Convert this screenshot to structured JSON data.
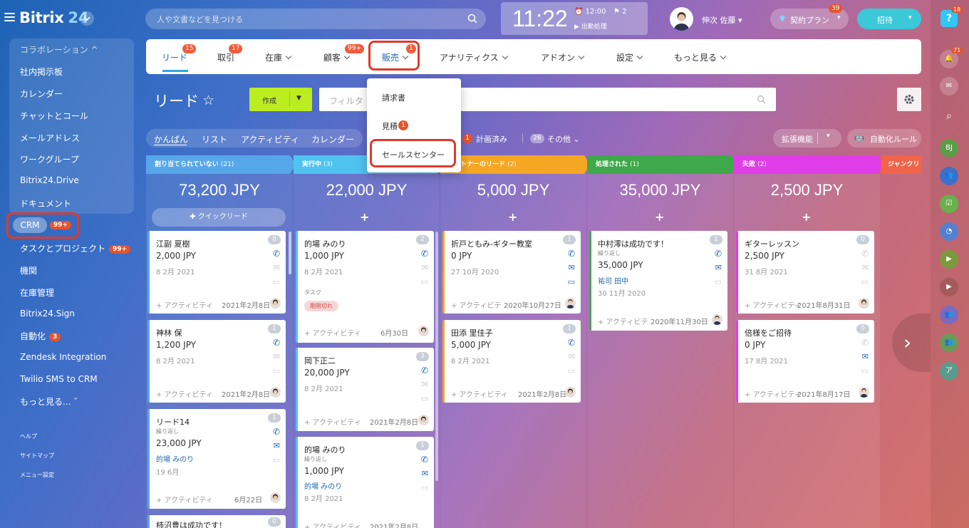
{
  "header": {
    "logo": "Bitrix",
    "logo_num": "24",
    "search_placeholder": "人や文書などを見つける",
    "clock_time": "11:22",
    "alarm": "12:00",
    "flag_count": "2",
    "clock_status": "出勤処理",
    "user_name": "伸次 佐藤",
    "plan_label": "契約プラン",
    "plan_badge": "39",
    "invite_label": "招待"
  },
  "right_strip": {
    "help_badge": "18",
    "bell_badge": "71",
    "avatar_bj": "BJ",
    "avatar_a": "ア"
  },
  "sidebar": {
    "group_title": "コラボレーション",
    "items": [
      "社内掲示板",
      "カレンダー",
      "チャットとコール",
      "メールアドレス",
      "ワークグループ",
      "Bitrix24.Drive",
      "ドキュメント"
    ],
    "crm": "CRM",
    "crm_badge": "99+",
    "items2": [
      "タスクとプロジェクト",
      "機関",
      "在庫管理",
      "Bitrix24.Sign",
      "自動化",
      "Zendesk Integration",
      "Twilio SMS to CRM",
      "もっと見る..."
    ],
    "task_badge": "99+",
    "auto_badge": "3",
    "small": [
      "ヘルプ",
      "サイトマップ",
      "メニュー設定"
    ]
  },
  "menu": {
    "items": [
      "リード",
      "取引",
      "在庫",
      "顧客",
      "販売",
      "アナリティクス",
      "アドオン",
      "設定",
      "もっと見る"
    ],
    "badges": {
      "lead": "15",
      "deal": "17",
      "client": "99+",
      "sales": "1"
    }
  },
  "dropdown": {
    "items": [
      "請求書",
      "見積",
      "セールスセンター"
    ],
    "quote_badge": "1"
  },
  "toolbar": {
    "title": "リード",
    "create": "作成",
    "filter_placeholder": "フィルタ"
  },
  "view_tabs": [
    "かんばん",
    "リスト",
    "アクティビティ",
    "カレンダー"
  ],
  "counters": {
    "planned_count": "1",
    "planned": "計画済み",
    "other_count": "26",
    "other": "その他"
  },
  "ext_label": "拡張機能",
  "auto_rules": "自動化ルール",
  "columns": [
    {
      "title": "割り当てられていない",
      "count": "(21)",
      "total": "73,200 JPY",
      "color": "#56a7ea"
    },
    {
      "title": "実行中",
      "count": "(3)",
      "total": "22,000 JPY",
      "color": "#4fc3ef"
    },
    {
      "title": "トナーのリード",
      "count": "(2)",
      "total": "5,000 JPY",
      "color": "#f5a623"
    },
    {
      "title": "処理された",
      "count": "(1)",
      "total": "35,000 JPY",
      "color": "#3fa84a"
    },
    {
      "title": "失敗",
      "count": "(2)",
      "total": "2,500 JPY",
      "color": "#e03de8"
    },
    {
      "title": "ジャンクリ",
      "count": "",
      "total": "",
      "color": "#f06449"
    }
  ],
  "quick_lead": "クイックリード",
  "cards": {
    "c1": {
      "name": "江副 夏樹",
      "amount": "2,000 JPY",
      "date": "8 2月 2021",
      "act": "+ アクティビティ",
      "adate": "2021年2月8日",
      "count": "0"
    },
    "c2": {
      "name": "神林 保",
      "amount": "1,200 JPY",
      "date": "8 2月 2021",
      "act": "+ アクティビティ",
      "adate": "2021年2月8日",
      "count": "1"
    },
    "c3": {
      "name": "リード14",
      "sub": "繰り返し",
      "amount": "23,000 JPY",
      "contact": "的場 みのり",
      "date": "19 6月",
      "act": "+ アクティビティ",
      "adate": "6月22日",
      "count": "1"
    },
    "c4": {
      "name": "柿沼豊は成功です！",
      "count": "0"
    },
    "c5": {
      "name": "的場 みのり",
      "amount": "1,000 JPY",
      "date": "8 2月 2021",
      "task": "タスク",
      "tag": "期限切れ",
      "act": "+ アクティビティ",
      "adate": "6月30日",
      "count": "2"
    },
    "c6": {
      "name": "岡下正二",
      "amount": "20,000 JPY",
      "date": "8 2月 2021",
      "act": "+ アクティビティ",
      "adate": "2021年2月8日",
      "count": "3"
    },
    "c7": {
      "name": "的場 みのり",
      "sub": "繰り返し",
      "amount": "1,000 JPY",
      "contact": "的場 みのり",
      "date": "8 2月 2021",
      "act": "+ アクティビティ",
      "adate": "2021年2月8日",
      "count": "1"
    },
    "c8": {
      "name": "折戸ともみ-ギター教室",
      "amount": "0 JPY",
      "date": "27 10月 2020",
      "act": "+ アクティビテ",
      "adate": "2020年10月27日",
      "count": "1"
    },
    "c9": {
      "name": "田添 里佳子",
      "amount": "5,000 JPY",
      "date": "8 2月 2021",
      "act": "+ アクティビティ",
      "adate": "2021年2月8日",
      "count": "1"
    },
    "c10": {
      "name": "中村澪は成功です！",
      "sub": "繰り返し",
      "amount": "35,000 JPY",
      "contact": "祐司 田中",
      "date": "30 11月 2020",
      "act": "+ アクティビテ",
      "adate": "2020年11月30日",
      "count": "1"
    },
    "c11": {
      "name": "ギターレッスン",
      "amount": "2,500 JPY",
      "date": "31 8月 2021",
      "act": "+ アクティビティ",
      "adate": "2021年8月31日",
      "count": "0"
    },
    "c12": {
      "name": "倍様をご招待",
      "amount": "0 JPY",
      "date": "17 8月 2021",
      "act": "+ アクティビティ",
      "adate": "2021年8月17日",
      "count": "0"
    }
  },
  "colors": {
    "highlight": "#e03a2a",
    "create": "#bbed21",
    "invite": "#3bc8d7",
    "badge": "#e6532b"
  }
}
